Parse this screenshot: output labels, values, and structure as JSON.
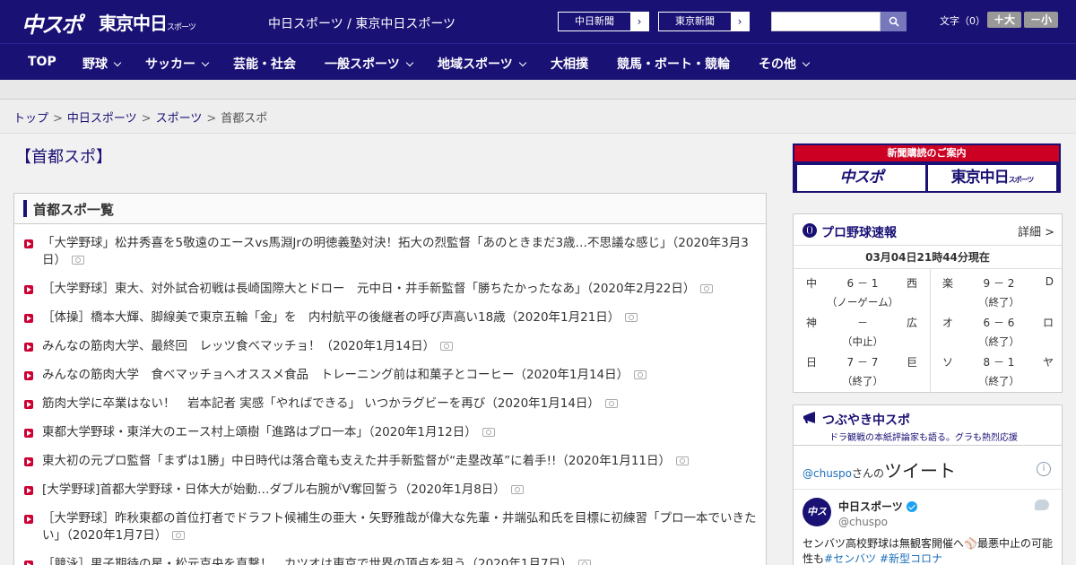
{
  "header": {
    "logo_chuspo": "中スポ",
    "logo_tokyo": "東京中日",
    "logo_tokyo_small": "スポーツ",
    "site_title": "中日スポーツ / 東京中日スポーツ",
    "paper_buttons": [
      {
        "label": "中日新聞"
      },
      {
        "label": "東京新聞"
      }
    ],
    "search_placeholder": "",
    "fontsize_label": "文字（0）",
    "font_bigger": "＋大",
    "font_smaller": "－小"
  },
  "nav": {
    "items": [
      {
        "label": "TOP",
        "has_menu": false
      },
      {
        "label": "野球",
        "has_menu": true
      },
      {
        "label": "サッカー",
        "has_menu": true
      },
      {
        "label": "芸能・社会",
        "has_menu": false
      },
      {
        "label": "一般スポーツ",
        "has_menu": true
      },
      {
        "label": "地域スポーツ",
        "has_menu": true
      },
      {
        "label": "大相撲",
        "has_menu": false
      },
      {
        "label": "競馬・ボート・競輪",
        "has_menu": false
      },
      {
        "label": "その他",
        "has_menu": true
      }
    ]
  },
  "breadcrumb": {
    "items": [
      "トップ",
      "中日スポーツ",
      "スポーツ"
    ],
    "current": "首都スポ",
    "separator": ">"
  },
  "main": {
    "page_title": "【首都スポ】",
    "list_heading": "首都スポ一覧",
    "articles": [
      {
        "text": "「大学野球」松井秀喜を5敬遠のエースvs馬淵Jrの明徳義塾対決！拓大の烈監督「あのときまだ3歳…不思議な感じ」（2020年3月3日）",
        "photo": true
      },
      {
        "text": "［大学野球］東大、対外試合初戦は長崎国際大とドロー　元中日・井手新監督「勝ちたかったなあ」（2020年2月22日）",
        "photo": true
      },
      {
        "text": "［体操］橋本大輝、脚線美で東京五輪「金」を　内村航平の後継者の呼び声高い18歳（2020年1月21日）",
        "photo": true
      },
      {
        "text": "みんなの筋肉大学、最終回　レッツ食べマッチョ！（2020年1月14日）",
        "photo": true
      },
      {
        "text": "みんなの筋肉大学　食べマッチョへオススメ食品　トレーニング前は和菓子とコーヒー（2020年1月14日）",
        "photo": true
      },
      {
        "text": "筋肉大学に卒業はない！　岩本記者 実感「やればできる」 いつかラグビーを再び（2020年1月14日）",
        "photo": true
      },
      {
        "text": "東都大学野球・東洋大のエース村上頌樹「進路はプロ一本」（2020年1月12日）",
        "photo": true
      },
      {
        "text": "東大初の元プロ監督「まずは1勝」中日時代は落合竜も支えた井手新監督が“走塁改革”に着手!!（2020年1月11日）",
        "photo": true
      },
      {
        "text": "[大学野球]首都大学野球・日体大が始動…ダブル右腕がV奪回誓う（2020年1月8日）",
        "photo": true
      },
      {
        "text": "［大学野球］昨秋東都の首位打者でドラフト候補生の亜大・矢野雅哉が偉大な先輩・井端弘和氏を目標に初練習「プロ一本でいきたい」（2020年1月7日）",
        "photo": true
      },
      {
        "text": "［競泳］男子期待の星・松元克央を直撃！　カツオは東京で世界の頂点を狙う（2020年1月7日）",
        "photo": true
      }
    ]
  },
  "sidebar": {
    "ad": {
      "top": "新聞購読のご案内",
      "left_logo": "中スポ",
      "right_logo": "東京中日",
      "right_logo_small": "スポーツ"
    },
    "baseball": {
      "title": "プロ野球速報",
      "detail": "詳細 >",
      "updated": "03月04日21時44分現在",
      "games": [
        {
          "home": "中",
          "away": "西",
          "score": "6 － 1",
          "status": "（ノーゲーム）"
        },
        {
          "home": "楽",
          "away": "D",
          "score": "9 － 2",
          "status": "（終了）"
        },
        {
          "home": "神",
          "away": "広",
          "score": "－",
          "status": "（中止）"
        },
        {
          "home": "オ",
          "away": "ロ",
          "score": "6 － 6",
          "status": "（終了）"
        },
        {
          "home": "日",
          "away": "巨",
          "score": "7 － 7",
          "status": "（終了）"
        },
        {
          "home": "ソ",
          "away": "ヤ",
          "score": "8 － 1",
          "status": "（終了）"
        }
      ]
    },
    "tsubuyaki": {
      "title": "つぶやき中スポ",
      "sub": "ドラ観戦の本紙評論家も語る。グラも熱烈応援"
    },
    "twitter": {
      "handle_link": "@chuspo",
      "handle_suffix": "さんの",
      "heading": "ツイート",
      "info": "i",
      "avatar_text": "中スポ",
      "name": "中日スポーツ",
      "handle": "@chuspo",
      "body_pre": "センバツ高校野球は無観客開催へ⚾最悪中止の可能性も",
      "tags": [
        "#センバツ",
        "#新型コロナ"
      ]
    }
  }
}
